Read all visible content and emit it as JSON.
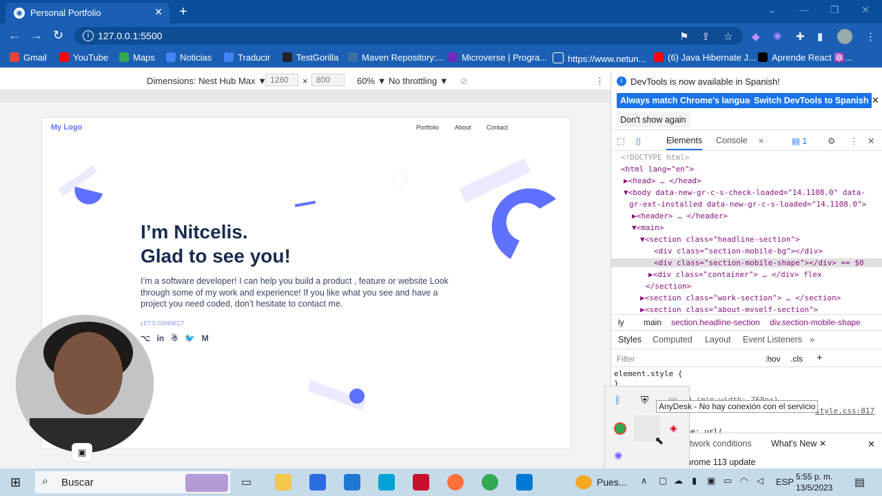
{
  "browser": {
    "tab_title": "Personal Portfolio",
    "url": "127.0.0.1:5500",
    "bookmarks": [
      "Gmail",
      "YouTube",
      "Maps",
      "Noticias",
      "Traducir",
      "TestGorilla",
      "Maven Repository:...",
      "Microverse | Progra...",
      "https://www.netun...",
      "(6) Java Hibernate J...",
      "Aprende React ⚛️..."
    ]
  },
  "device_toolbar": {
    "dimensions_label": "Dimensions: Nest Hub Max ▼",
    "width": "1280",
    "height": "800",
    "times": "×",
    "zoom": "60% ▼",
    "throttling": "No throttling ▼"
  },
  "page": {
    "logo": "My Logo",
    "nav": [
      "Portfolio",
      "About",
      "Contact"
    ],
    "headline_1": "I’m Nitcelis.",
    "headline_2": "Glad to see you!",
    "intro": "I’m a software developer! I can help you build a product , feature or website Look through some of my work and experience! If you like what you see and have a project you need coded, don’t hesitate to contact me.",
    "connect": "LET’S CONNECT",
    "socials": [
      "⌥",
      "in",
      "☃",
      "🐦",
      "M"
    ]
  },
  "devtools": {
    "info": "DevTools is now available in Spanish!",
    "btn_match": "Always match Chrome's language",
    "btn_switch": "Switch DevTools to Spanish",
    "btn_dont": "Don't show again",
    "tabs": [
      "Elements",
      "Console",
      "»"
    ],
    "issue_count": "1",
    "dom": [
      "<!DOCTYPE html>",
      "<html lang=\"en\">",
      "▶<head> … </head>",
      "▼<body data-new-gr-c-s-check-loaded=\"14.1108.0\" data-",
      "gr-ext-installed data-new-gr-c-s-loaded=\"14.1108.0\">",
      "▶<header> … </header>",
      "▼<main>",
      "▼<section class=\"headline-section\">",
      "<div class=\"section-mobile-bg\"></div>",
      "<div class=\"section-mobile-shape\"></div> == $0",
      "▶<div class=\"container\"> … </div> flex",
      "</section>",
      "▶<section class=\"work-section\"> … </section>",
      "▶<section class=\"about-myself-section\">"
    ],
    "breadcrumbs": [
      "ly",
      "main",
      "section.headline-section",
      "div.section-mobile-shape"
    ],
    "styles_tabs": [
      "Styles",
      "Computed",
      "Layout",
      "Event Listeners",
      "»"
    ],
    "filter_placeholder": "Filter",
    "filter_hov": ":hov",
    "filter_cls": ".cls",
    "styles_lines": [
      "element.style {",
      "}",
      "@media screen and (min-width: 768px)",
      "style.css:817",
      "background-image: url("
    ],
    "drawer_tabs": [
      "Network conditions",
      "What's New"
    ],
    "drawer_text": "Chrome 113 update"
  },
  "tray_tooltip": "AnyDesk - No hay conexión con el servicio",
  "taskbar": {
    "search_label": "Buscar",
    "weather": "Pues...",
    "lang": "ESP",
    "time": "5:55 p. m.",
    "date": "13/5/2023"
  },
  "colors": {
    "accent": "#6070ff",
    "chrome_blue": "#1a5fb4",
    "heading": "#172b4d"
  }
}
